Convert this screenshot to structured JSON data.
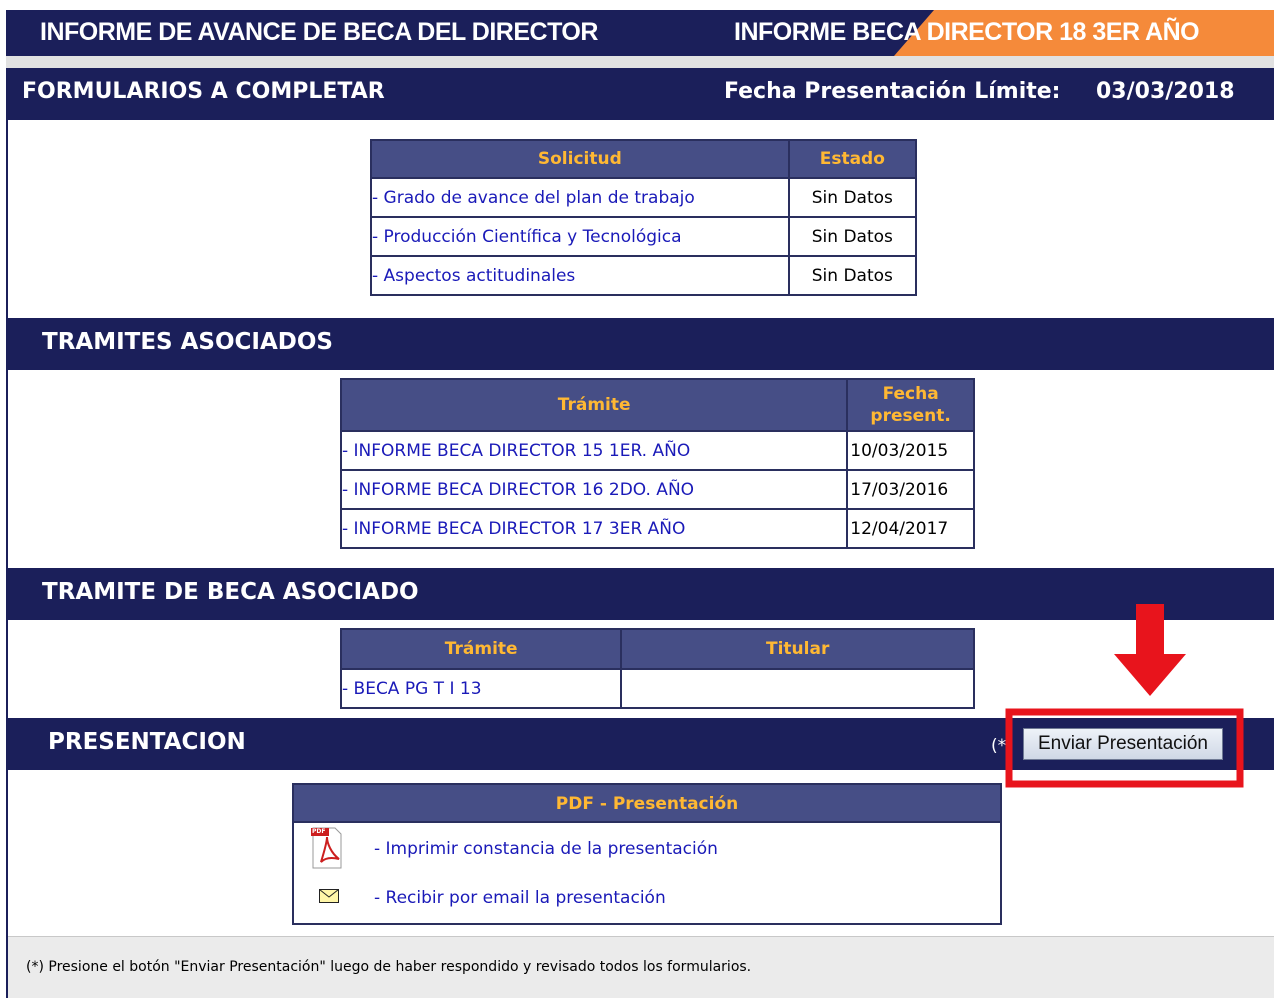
{
  "header": {
    "title_left": "INFORME DE AVANCE DE BECA DEL DIRECTOR",
    "title_right": "INFORME BECA DIRECTOR 18 3ER AÑO"
  },
  "forms_section": {
    "title": "FORMULARIOS A COMPLETAR",
    "deadline_label": "Fecha Presentación Límite:",
    "deadline_value": "03/03/2018",
    "columns": [
      "Solicitud",
      "Estado"
    ],
    "rows": [
      {
        "name": "- Grado de avance del plan de trabajo",
        "status": "Sin Datos"
      },
      {
        "name": "- Producción Científica y Tecnológica",
        "status": "Sin Datos"
      },
      {
        "name": "- Aspectos actitudinales",
        "status": "Sin Datos"
      }
    ]
  },
  "tramites_section": {
    "title": "TRAMITES ASOCIADOS",
    "col_tramite": "Trámite",
    "col_fecha_1": "Fecha",
    "col_fecha_2": "present.",
    "rows": [
      {
        "name": "- INFORME BECA DIRECTOR 15 1ER. AÑO",
        "date": "10/03/2015"
      },
      {
        "name": "- INFORME BECA DIRECTOR 16 2DO. AÑO",
        "date": "17/03/2016"
      },
      {
        "name": "- INFORME BECA DIRECTOR 17 3ER AÑO",
        "date": "12/04/2017"
      }
    ]
  },
  "beca_section": {
    "title": "TRAMITE DE BECA ASOCIADO",
    "columns": [
      "Trámite",
      "Titular"
    ],
    "rows": [
      {
        "tramite": "- BECA PG T I 13",
        "titular": ""
      }
    ]
  },
  "presentacion_section": {
    "title": "PRESENTACION",
    "asterisk": "(*",
    "send_button": "Enviar Presentación"
  },
  "pdf_section": {
    "header": "PDF - Presentación",
    "print_link": "- Imprimir constancia de la presentación",
    "email_link": "- Recibir por email la presentación",
    "pdf_icon_text": "PDF"
  },
  "footer": {
    "note": "(*) Presione el botón \"Enviar Presentación\" luego de haber respondido y revisado todos los formularios."
  },
  "annotation": {
    "arrow_color": "#e8141c",
    "highlight_color": "#e8141c"
  }
}
